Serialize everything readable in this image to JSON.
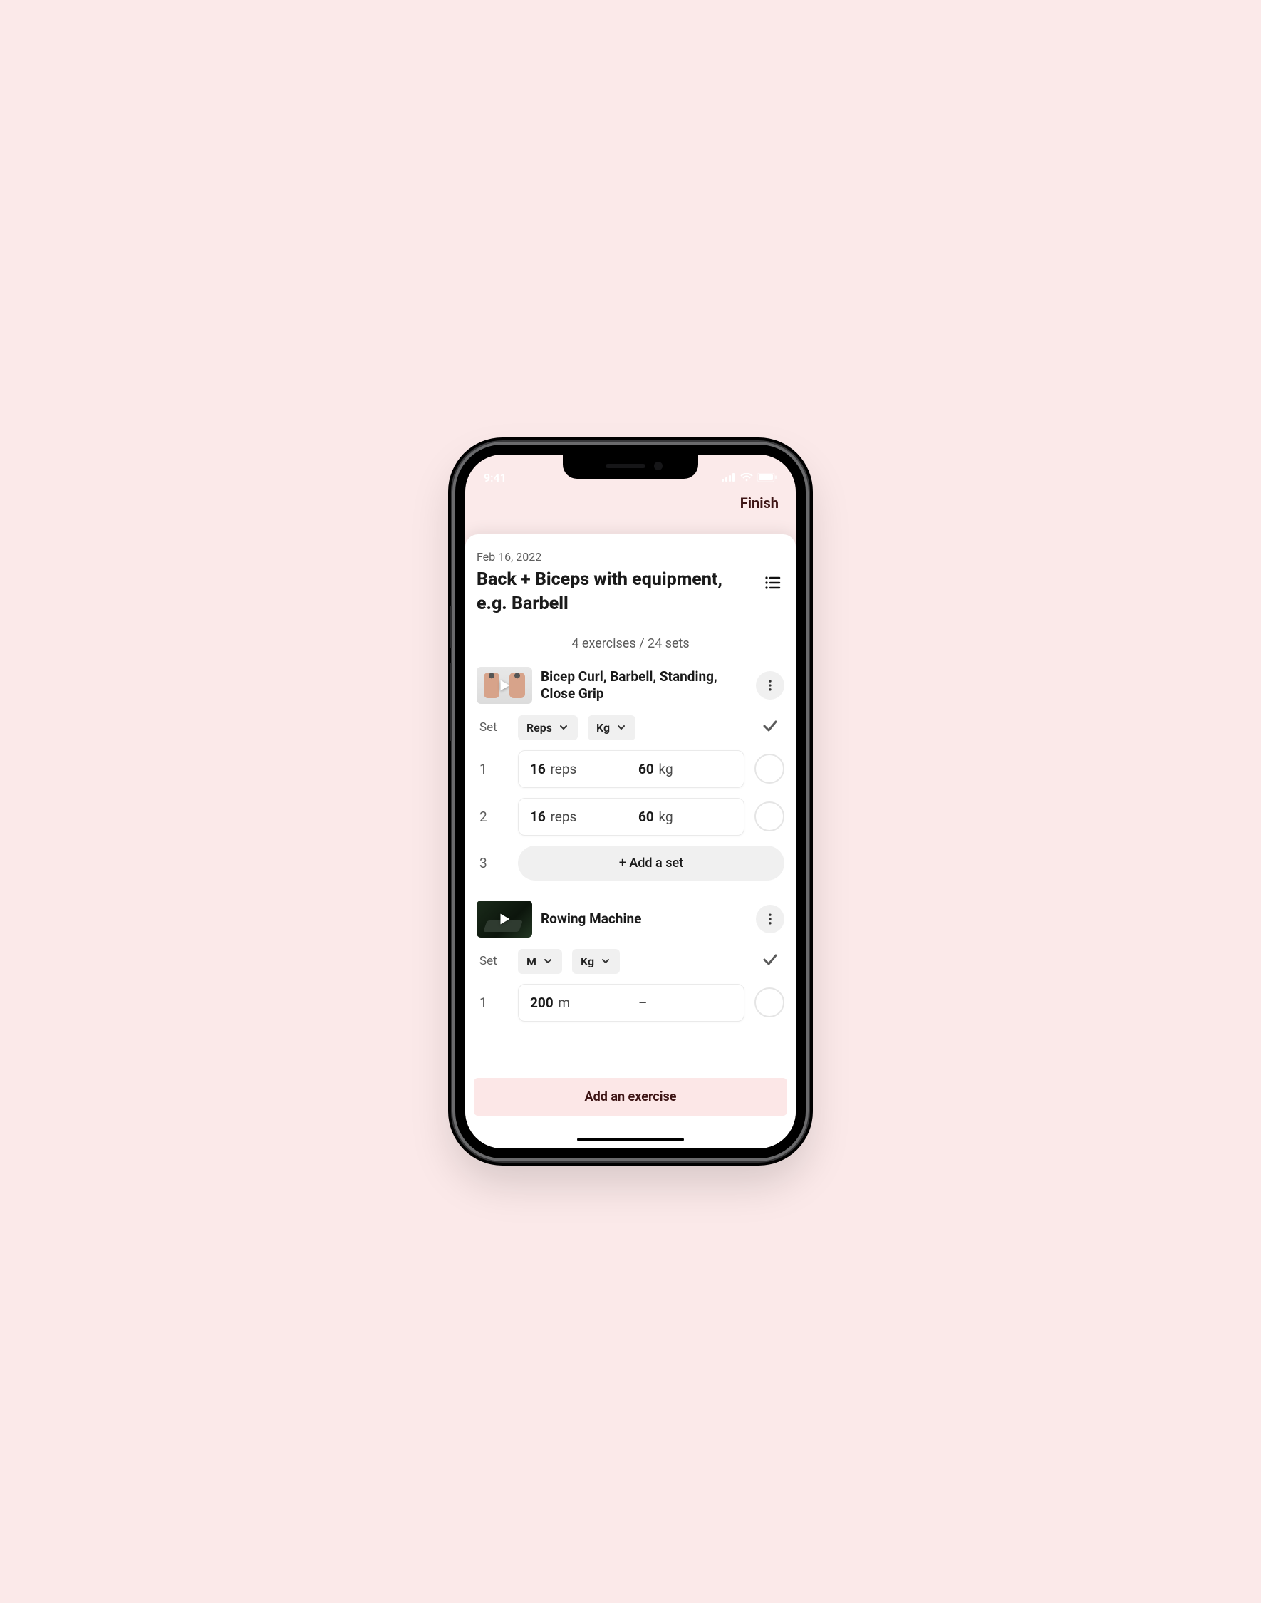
{
  "status": {
    "time": "9:41"
  },
  "header": {
    "finish": "Finish"
  },
  "workout": {
    "date": "Feb 16, 2022",
    "title": "Back + Biceps with equipment, e.g. Barbell",
    "summary_exercises": "4",
    "summary_sets": "24",
    "summary_label_a": "exercises",
    "summary_label_b": "sets"
  },
  "ex1": {
    "name": "Bicep Curl, Barbell, Standing, Close Grip",
    "col_set": "Set",
    "metric_a": "Reps",
    "metric_b": "Kg",
    "set1_num": "1",
    "set1_a_value": "16",
    "set1_a_unit": "reps",
    "set1_b_value": "60",
    "set1_b_unit": "kg",
    "set2_num": "2",
    "set2_a_value": "16",
    "set2_a_unit": "reps",
    "set2_b_value": "60",
    "set2_b_unit": "kg",
    "set3_num": "3",
    "add_set": "+ Add a set"
  },
  "ex2": {
    "name": "Rowing Machine",
    "col_set": "Set",
    "metric_a": "M",
    "metric_b": "Kg",
    "set1_num": "1",
    "set1_a_value": "200",
    "set1_a_unit": "m",
    "set1_b_value": "–"
  },
  "footer": {
    "add_exercise": "Add an exercise"
  }
}
